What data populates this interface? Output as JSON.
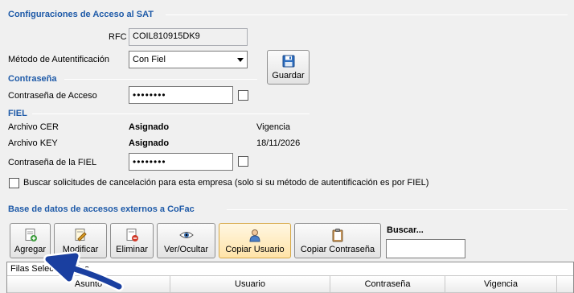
{
  "sat_section": {
    "title": "Configuraciones de Acceso al SAT",
    "rfc_label": "RFC",
    "rfc_value": "COIL810915DK9",
    "auth_method_label": "Método de Autentificación",
    "auth_method_value": "Con Fiel",
    "save_label": "Guardar"
  },
  "password_section": {
    "title": "Contraseña",
    "access_password_label": "Contraseña de Acceso",
    "access_password_value": "••••••••"
  },
  "fiel_section": {
    "title": "FIEL",
    "cer_label": "Archivo CER",
    "cer_status": "Asignado",
    "key_label": "Archivo KEY",
    "key_status": "Asignado",
    "validity_label": "Vigencia",
    "validity_date": "18/11/2026",
    "fiel_password_label": "Contraseña de la FIEL",
    "fiel_password_value": "••••••••",
    "cancel_requests_label": "Buscar solicitudes de cancelación para esta empresa (solo si su método de autentificación es por FIEL)"
  },
  "external_db": {
    "title": "Base de datos de accesos externos a CoFac",
    "toolbar": {
      "add": "Agregar",
      "edit": "Modificar",
      "delete": "Eliminar",
      "toggle_view": "Ver/Ocultar",
      "copy_user": "Copiar Usuario",
      "copy_password": "Copiar Contraseña"
    },
    "search_label": "Buscar...",
    "search_value": "",
    "selected_rows_label": "Filas Seleccionadas",
    "columns": [
      "Asunto",
      "Usuario",
      "Contraseña",
      "Vigencia"
    ]
  },
  "colors": {
    "section_title": "#1e5aa8",
    "arrow": "#1a3fa0"
  }
}
